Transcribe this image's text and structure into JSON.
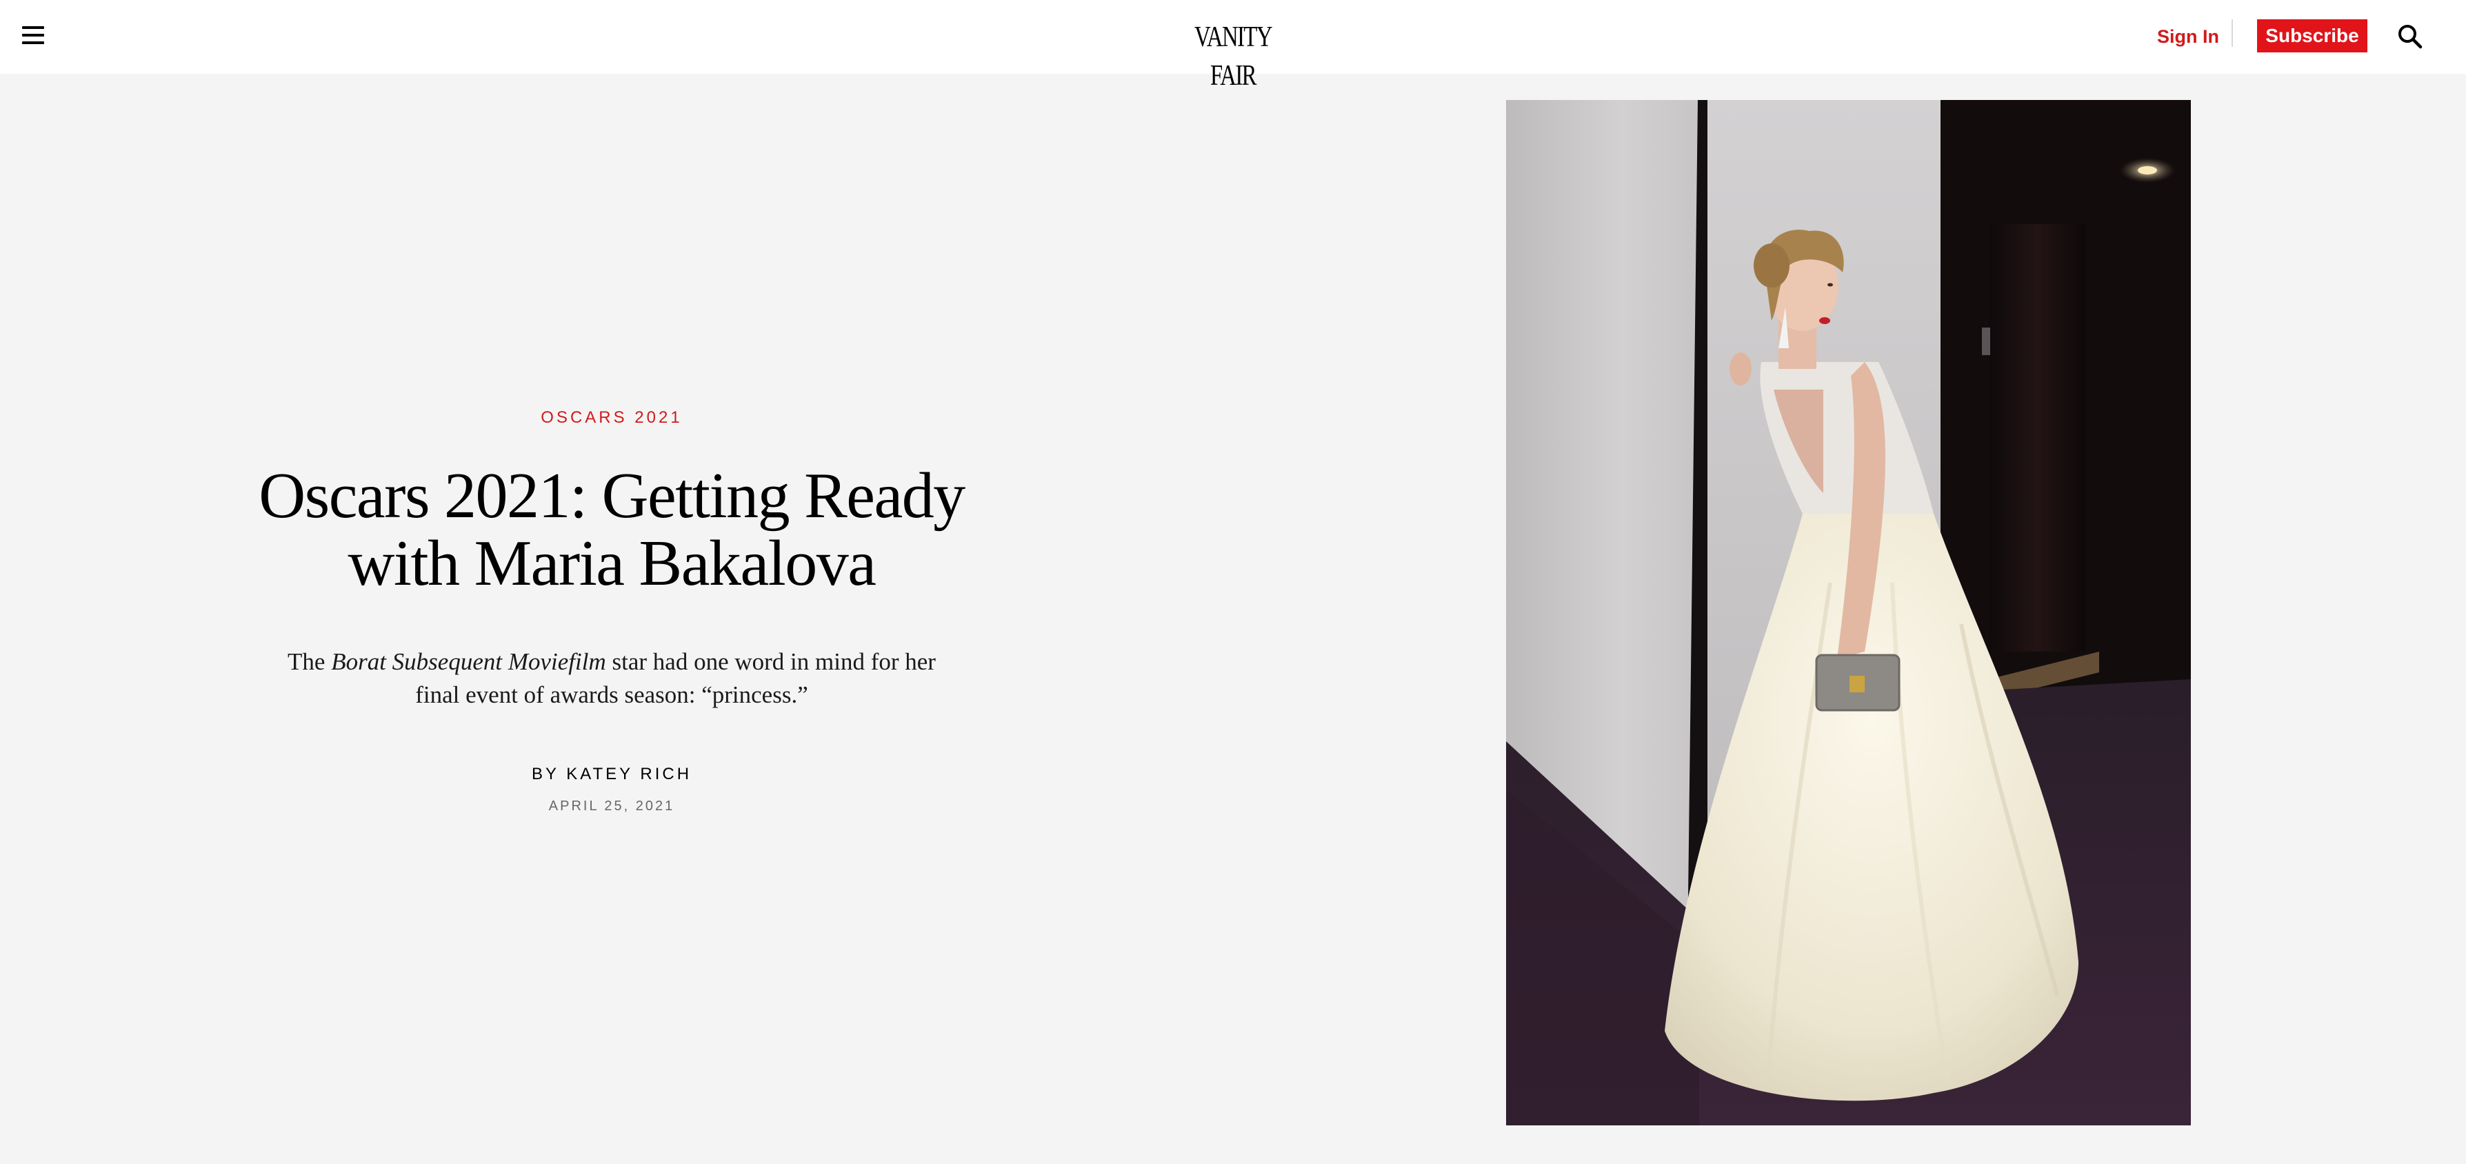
{
  "nav": {
    "menu_icon": "hamburger-menu-icon",
    "logo": "VANITY FAIR",
    "sign_in_label": "Sign In",
    "subscribe_label": "Subscribe",
    "search_icon": "search-icon"
  },
  "article": {
    "rubric": "OSCARS 2021",
    "headline_line1": "Oscars 2021: Getting Ready",
    "headline_line2": "with Maria Bakalova",
    "dek_prefix": "The ",
    "dek_italic": "Borat Subsequent Moviefilm",
    "dek_line1_rest": " star had one word in mind for her",
    "dek_line2": "final event of awards season: “princess.”",
    "byline_prefix": "BY ",
    "author": "KATEY RICH",
    "date": "APRIL 25, 2021"
  },
  "colors": {
    "accent_red": "#e1141a",
    "page_background": "#f4f4f4",
    "nav_background": "#ffffff"
  }
}
